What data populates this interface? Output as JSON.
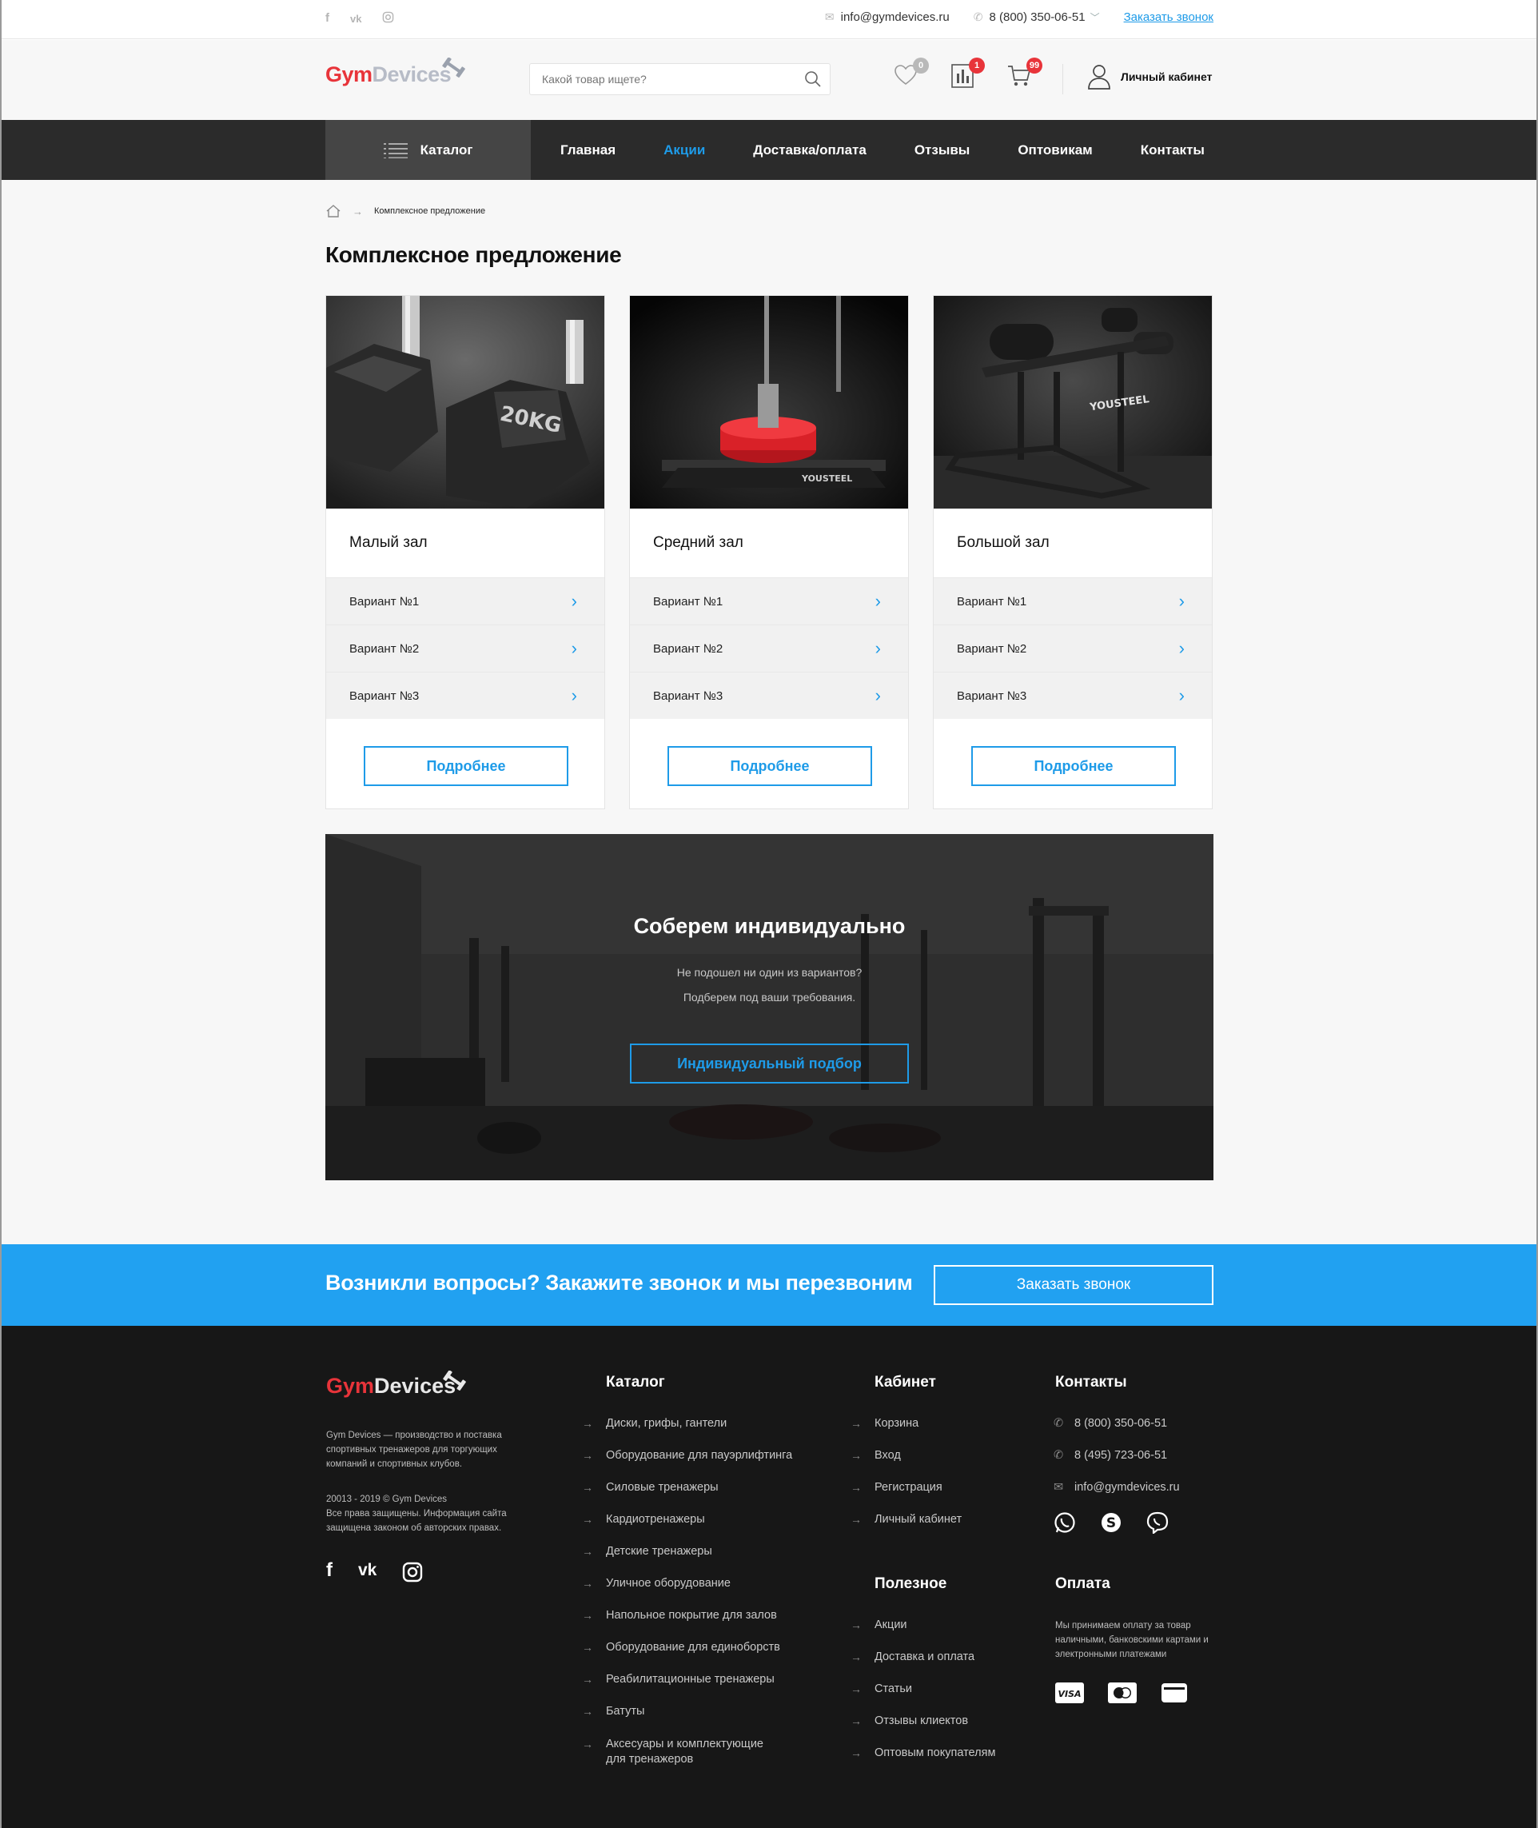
{
  "topbar": {
    "social": [
      "f",
      "vk",
      "ig"
    ],
    "email": "info@gymdevices.ru",
    "phone": "8 (800) 350-06-51",
    "callback": "Заказать звонок"
  },
  "header": {
    "logo_gym": "Gym",
    "logo_devices": "Devices",
    "search_placeholder": "Какой товар ищете?",
    "favorites_count": "0",
    "compare_count": "1",
    "cart_count": "99",
    "account": "Личный кабинет"
  },
  "nav": {
    "catalog": "Каталог",
    "items": [
      "Главная",
      "Акции",
      "Доставка/оплата",
      "Отзывы",
      "Оптовикам",
      "Контакты"
    ],
    "active": "Акции"
  },
  "breadcrumb": {
    "current": "Комплексное предложение"
  },
  "page_title": "Комплексное предложение",
  "cards": [
    {
      "title": "Малый зал",
      "variants": [
        "Вариант №1",
        "Вариант №2",
        "Вариант №3"
      ],
      "button": "Подробнее"
    },
    {
      "title": "Средний зал",
      "variants": [
        "Вариант №1",
        "Вариант №2",
        "Вариант №3"
      ],
      "button": "Подробнее"
    },
    {
      "title": "Большой зал",
      "variants": [
        "Вариант №1",
        "Вариант №2",
        "Вариант №3"
      ],
      "button": "Подробнее"
    }
  ],
  "banner": {
    "title": "Соберем индивидуально",
    "line1": "Не подошел ни один из вариантов?",
    "line2": "Подберем под ваши требования.",
    "button": "Индивидуальный подбор"
  },
  "strip": {
    "text": "Возникли вопросы? Закажите звонок и мы перезвоним",
    "button": "Заказать звонок"
  },
  "footer": {
    "logo_gym": "Gym",
    "logo_devices": "Devices",
    "description": "Gym Devices  — производство и поставка спортивных тренажеров для торгующих компаний и спортивных клубов.",
    "copyright": "20013 - 2019 © Gym Devices",
    "rights": "Все права защищены. Информация сайта защищена законом об авторских правах.",
    "catalog_title": "Каталог",
    "catalog": [
      "Диски, грифы, гантели",
      "Оборудование для пауэрлифтинга",
      "Силовые тренажеры",
      "Кардиотренажеры",
      "Детские тренажеры",
      "Уличное оборудование",
      "Напольное покрытие для залов",
      "Оборудование для единоборств",
      "Реабилитационные тренажеры",
      "Батуты",
      "Аксесуары и комплектующие для тренажеров"
    ],
    "cabinet_title": "Кабинет",
    "cabinet": [
      "Корзина",
      "Вход",
      "Регистрация",
      "Личный кабинет"
    ],
    "useful_title": "Полезное",
    "useful": [
      "Акции",
      "Доставка и оплата",
      "Статьи",
      "Отзывы клиектов",
      "Оптовым покупателям"
    ],
    "contacts_title": "Контакты",
    "contacts": [
      "8 (800) 350-06-51",
      "8 (495) 723-06-51",
      "info@gymdevices.ru"
    ],
    "payment_title": "Оплата",
    "payment_text": "Мы принимаем оплату за товар наличными, банковскими картами и электронными платежами",
    "visa": "VISA"
  },
  "colors": {
    "accent": "#1e9be8",
    "strip": "#21a1f1",
    "brand_red": "#e8343a",
    "nav": "#2b2b2b",
    "footer": "#171717"
  }
}
